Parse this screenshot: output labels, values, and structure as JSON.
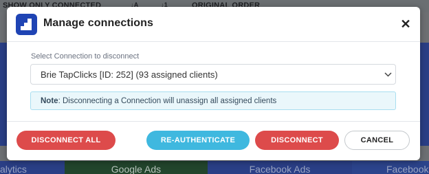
{
  "background": {
    "toolbar": [
      "SHOW ONLY CONNECTED",
      "ORIGINAL ORDER"
    ],
    "tabs": [
      "alytics",
      "Google Ads",
      "Facebook Ads",
      "Facebook"
    ]
  },
  "modal": {
    "title": "Manage connections",
    "close_label": "✕",
    "select_label": "Select Connection to disconnect",
    "selected_connection": "Brie TapClicks [ID: 252] (93 assigned clients)",
    "note_prefix": "Note",
    "note_text": ": Disconnecting a Connection will unassign all assigned clients",
    "buttons": {
      "disconnect_all": "DISCONNECT ALL",
      "reauthenticate": "RE-AUTHENTICATE",
      "disconnect": "DISCONNECT",
      "cancel": "CANCEL"
    }
  },
  "colors": {
    "danger": "#dd4b4b",
    "info": "#3fb8df",
    "brand": "#1f44b4",
    "note_bg": "#eaf7fb"
  }
}
